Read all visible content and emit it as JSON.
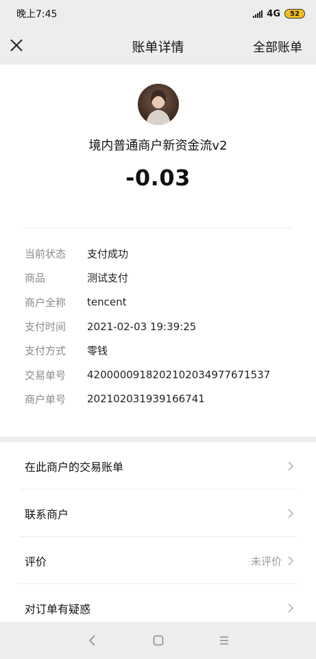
{
  "status_bar": {
    "time": "晚上7:45",
    "network": "4G",
    "battery": "52"
  },
  "header": {
    "title": "账单详情",
    "right_action": "全部账单",
    "close_icon": "close-icon"
  },
  "transaction": {
    "merchant_name": "境内普通商户新资金流v2",
    "amount": "-0.03"
  },
  "details": [
    {
      "label": "当前状态",
      "value": "支付成功"
    },
    {
      "label": "商品",
      "value": "测试支付"
    },
    {
      "label": "商户全称",
      "value": "tencent"
    },
    {
      "label": "支付时间",
      "value": "2021-02-03 19:39:25"
    },
    {
      "label": "支付方式",
      "value": "零钱"
    },
    {
      "label": "交易单号",
      "value": "4200000918202102034977671537"
    },
    {
      "label": "商户单号",
      "value": "202102031939166741"
    }
  ],
  "actions": [
    {
      "label": "在此商户的交易账单"
    },
    {
      "label": "联系商户"
    },
    {
      "label": "评价",
      "status": "未评价"
    },
    {
      "label": "对订单有疑惑"
    }
  ],
  "nav_icons": [
    "back-icon",
    "home-icon",
    "menu-icon"
  ]
}
